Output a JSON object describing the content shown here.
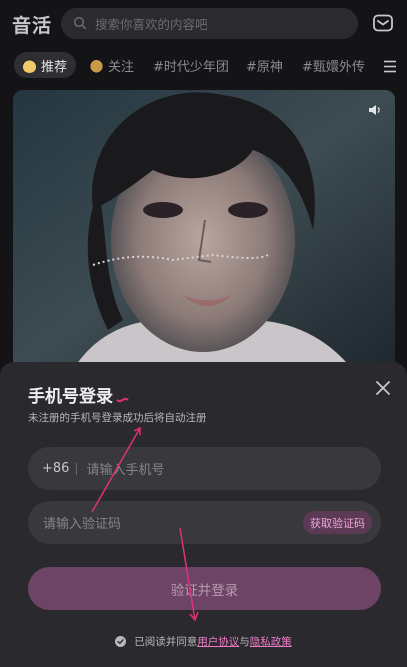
{
  "header": {
    "logo": "音活",
    "search_placeholder": "搜索你喜欢的内容吧",
    "icons": {
      "search": "search-icon",
      "mail": "mail-icon"
    }
  },
  "tabs": [
    {
      "label": "推荐",
      "active": true
    },
    {
      "label": "关注",
      "active": false
    },
    {
      "label": "#时代少年团",
      "active": false
    },
    {
      "label": "#原神",
      "active": false
    },
    {
      "label": "#甄嬛外传",
      "active": false
    }
  ],
  "login": {
    "title": "手机号登录",
    "subtitle": "未注册的手机号登录成功后将自动注册",
    "country_code": "+86",
    "phone_placeholder": "请输入手机号",
    "code_placeholder": "请输入验证码",
    "get_code": "获取验证码",
    "submit": "验证并登录",
    "agree_prefix": "已阅读并同意",
    "user_agreement": "用户协议",
    "and": "与",
    "privacy_policy": "隐私政策"
  },
  "colors": {
    "accent": "#f07ac8",
    "submit_bg": "#6e4466",
    "sheet_bg": "#2a2a2e",
    "annotation": "#e0307a"
  }
}
